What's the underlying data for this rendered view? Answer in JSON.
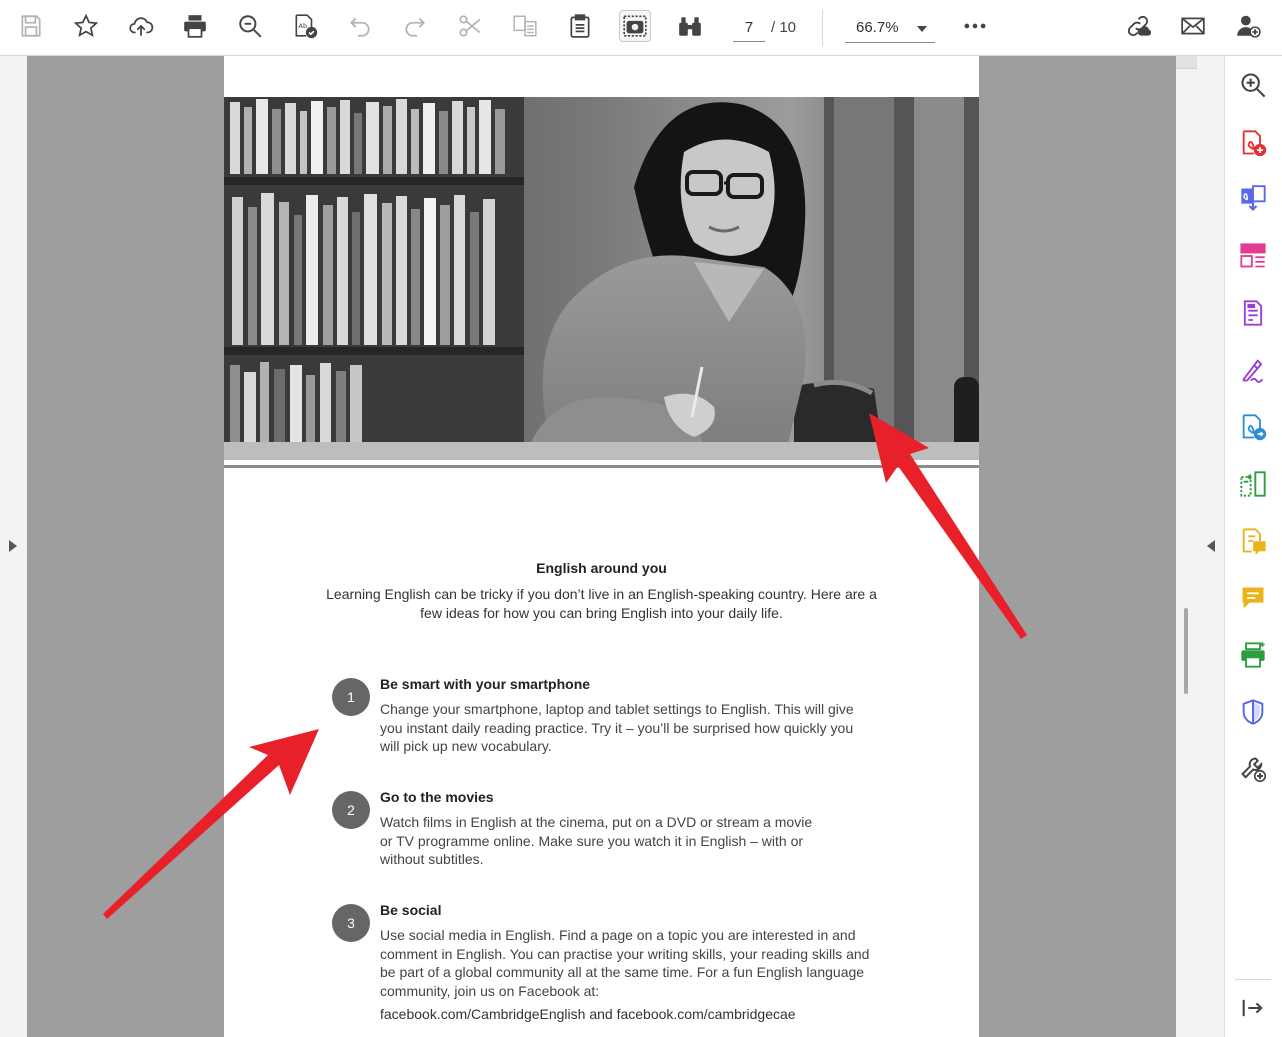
{
  "toolbar": {
    "icons": [
      "save-icon",
      "star-icon",
      "upload-cloud-icon",
      "print-icon",
      "zoom-search-icon",
      "spellcheck-doc-icon",
      "undo-icon",
      "redo-icon",
      "scissors-icon",
      "copy-format-icon",
      "clipboard-icon",
      "snapshot-icon",
      "binoculars-icon",
      "more-icon",
      "share-link-icon",
      "mail-icon",
      "add-user-icon"
    ],
    "current_page": "7",
    "total_pages": "/ 10",
    "zoom": "66.7%"
  },
  "sidebar": {
    "tools": [
      "zoom-in-tool",
      "create-pdf-tool",
      "combine-files-tool",
      "organize-pages-tool",
      "edit-pdf-tool",
      "fill-sign-tool",
      "export-pdf-tool",
      "compress-tool",
      "comment-doc-tool",
      "comment-tool",
      "print-production-tool",
      "protect-tool",
      "more-tools-tool",
      "collapse-panel"
    ],
    "colors": {
      "red": "#e5312f",
      "blue": "#5868e6",
      "pink": "#e23c8f",
      "purple": "#9a3fcf",
      "teal": "#2d8fd6",
      "green": "#2e9e3d",
      "yellow": "#e9b31a",
      "gray": "#444444"
    }
  },
  "document": {
    "heading": "English around you",
    "intro": "Learning English can be tricky if you don’t live in an English-speaking country. Here are a few ideas for how you can bring English into your daily life.",
    "tips": [
      {
        "number": "1",
        "title": "Be smart with your smartphone",
        "body": "Change your smartphone, laptop and tablet settings to English. This will give you instant daily reading practice. Try it – you’ll be surprised how quickly you will pick up new vocabulary."
      },
      {
        "number": "2",
        "title": "Go to the movies",
        "body": "Watch films in English at the cinema, put on a DVD or stream a movie or TV programme online. Make sure you watch it in English – with or without subtitles."
      },
      {
        "number": "3",
        "title": "Be social",
        "body": "Use social media in English. Find a page on a topic you are interested in and comment in English. You can practise your writing skills, your reading skills and be part of a global community all at the same time. For a fun English language community, join us on Facebook at:"
      }
    ],
    "links": "facebook.com/CambridgeEnglish and facebook.com/cambridgecae"
  },
  "annotations": {
    "arrow_color": "#e8202a"
  }
}
